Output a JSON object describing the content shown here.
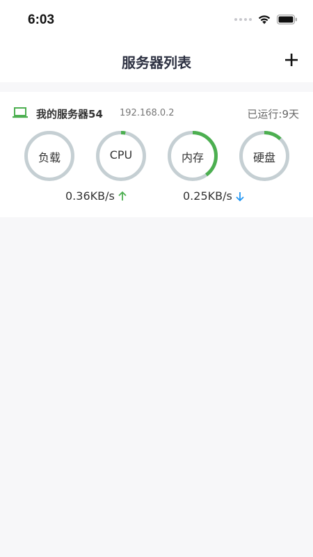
{
  "status_bar": {
    "time": "6:03",
    "icons": [
      "signal-dots-icon",
      "wifi-icon",
      "battery-icon"
    ]
  },
  "header": {
    "title": "服务器列表",
    "add_icon": "plus-icon"
  },
  "colors": {
    "accent_green": "#4caf50",
    "gauge_track": "#c5cfd3",
    "download_blue": "#2196f3"
  },
  "server": {
    "name": "我的服务器54",
    "ip": "192.168.0.2",
    "uptime": "已运行:9天",
    "icon": "laptop-icon",
    "gauges": [
      {
        "label": "负载",
        "value": 0.0
      },
      {
        "label": "CPU",
        "value": 0.03
      },
      {
        "label": "内存",
        "value": 0.4
      },
      {
        "label": "硬盘",
        "value": 0.12
      }
    ],
    "upload": "0.36KB/s",
    "download": "0.25KB/s"
  }
}
